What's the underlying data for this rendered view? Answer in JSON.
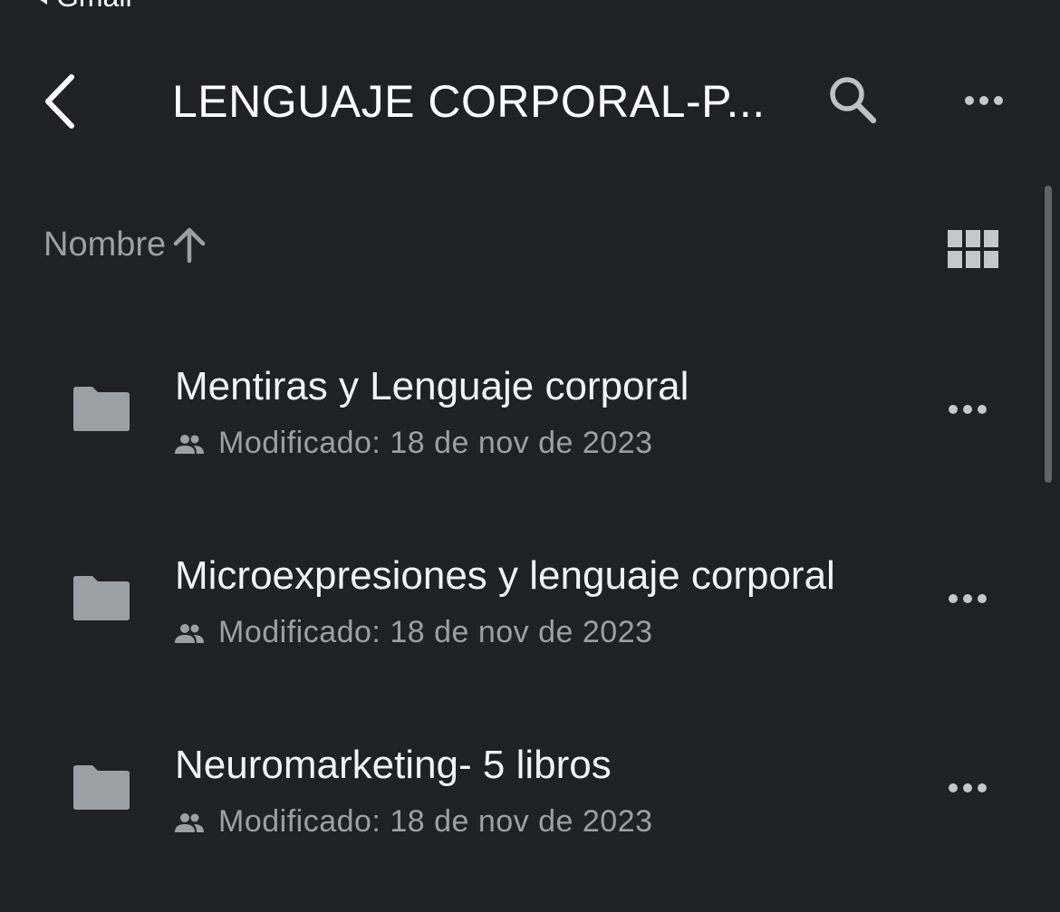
{
  "status": {
    "back_label": "Gmail"
  },
  "header": {
    "title": "LENGUAJE CORPORAL-P...",
    "back_icon": "chevron-left-icon",
    "search_icon": "search-icon",
    "more_icon": "more-horizontal-icon"
  },
  "sort": {
    "label": "Nombre",
    "direction_icon": "arrow-up-icon",
    "view_icon": "grid-view-icon"
  },
  "colors": {
    "background": "#202124",
    "text_primary": "#f1f3f4",
    "text_secondary": "#9aa0a6",
    "folder": "#9aa0a6"
  },
  "files": [
    {
      "name": "Mentiras y Lenguaje corporal",
      "meta": "Modificado: 18 de nov de 2023",
      "icon": "folder-icon",
      "shared": true
    },
    {
      "name": "Microexpresiones y lenguaje corporal",
      "meta": "Modificado: 18 de nov de 2023",
      "icon": "folder-icon",
      "shared": true
    },
    {
      "name": "Neuromarketing- 5 libros",
      "meta": "Modificado: 18 de nov de 2023",
      "icon": "folder-icon",
      "shared": true
    }
  ]
}
